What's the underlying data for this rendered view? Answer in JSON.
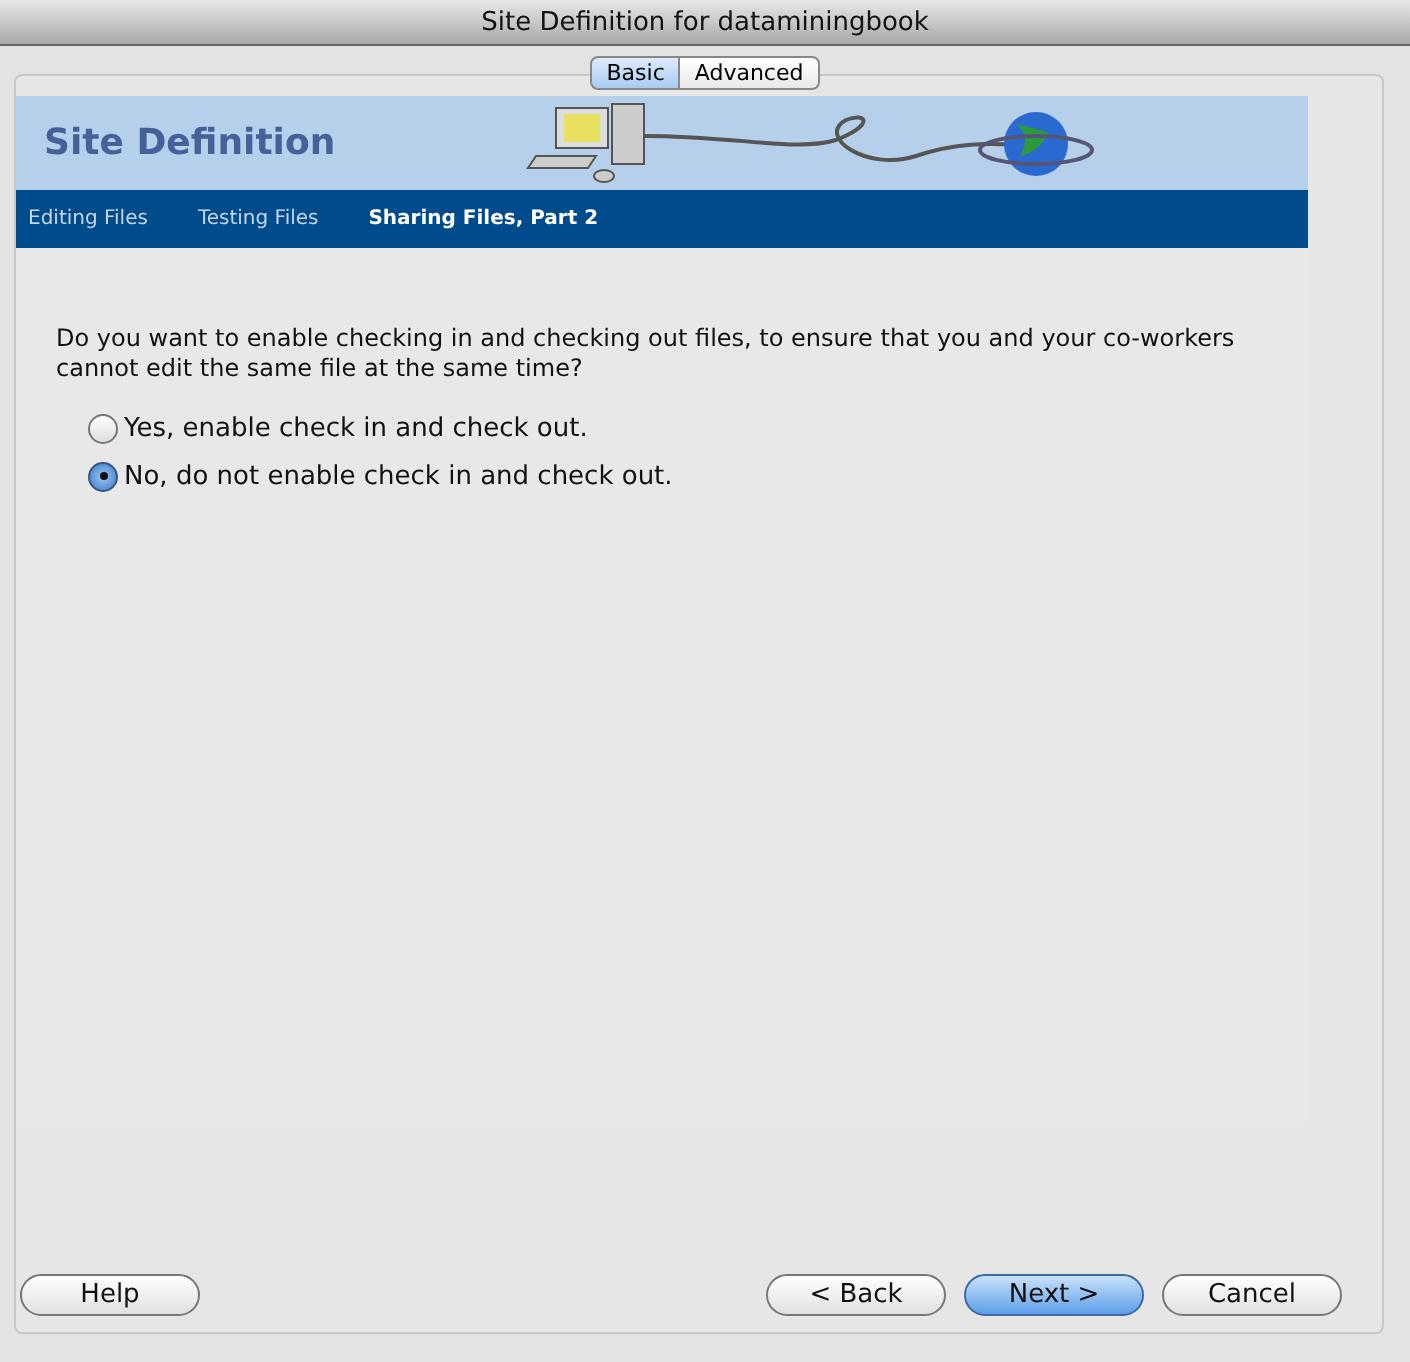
{
  "window": {
    "title": "Site Definition for dataminingbook"
  },
  "tabs": [
    {
      "label": "Basic",
      "selected": true
    },
    {
      "label": "Advanced",
      "selected": false
    }
  ],
  "banner": {
    "title": "Site Definition"
  },
  "steps": [
    {
      "label": "Editing Files",
      "selected": false
    },
    {
      "label": "Testing Files",
      "selected": false
    },
    {
      "label": "Sharing Files, Part 2",
      "selected": true
    }
  ],
  "question": "Do you want to enable checking in and checking out files, to ensure that you and your co-workers cannot edit the same file at the same time?",
  "options": [
    {
      "label": "Yes, enable check in and check out.",
      "selected": false
    },
    {
      "label": "No, do not enable check in and check out.",
      "selected": true
    }
  ],
  "buttons": [
    {
      "label": "Help",
      "kind": "help",
      "default": false
    },
    {
      "label": "< Back",
      "kind": "nav",
      "default": false
    },
    {
      "label": "Next >",
      "kind": "nav",
      "default": true
    },
    {
      "label": "Cancel",
      "kind": "nav",
      "default": false
    }
  ]
}
